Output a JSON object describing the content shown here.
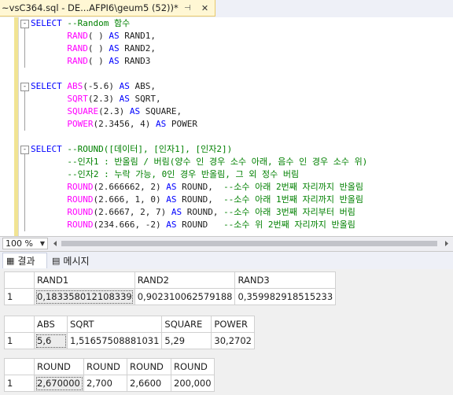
{
  "tab": {
    "title": "~vsC364.sql - DE...AFPI6\\geum5 (52))*",
    "pin_glyph": "⊣",
    "close_glyph": "✕"
  },
  "editor": {
    "lines": [
      {
        "fold": "-",
        "tokens": [
          {
            "t": "SELECT",
            "c": "kw"
          },
          {
            "t": " --Random 함수",
            "c": "cm"
          }
        ]
      },
      {
        "fold": "",
        "tokens": [
          {
            "t": "       RAND",
            "c": "fn"
          },
          {
            "t": "( ) ",
            "c": "pl"
          },
          {
            "t": "AS",
            "c": "kw"
          },
          {
            "t": " RAND1,",
            "c": "pl"
          }
        ]
      },
      {
        "fold": "",
        "tokens": [
          {
            "t": "       RAND",
            "c": "fn"
          },
          {
            "t": "( ) ",
            "c": "pl"
          },
          {
            "t": "AS",
            "c": "kw"
          },
          {
            "t": " RAND2,",
            "c": "pl"
          }
        ]
      },
      {
        "fold": "",
        "tokens": [
          {
            "t": "       RAND",
            "c": "fn"
          },
          {
            "t": "( ) ",
            "c": "pl"
          },
          {
            "t": "AS",
            "c": "kw"
          },
          {
            "t": " RAND3",
            "c": "pl"
          }
        ]
      },
      {
        "fold": "",
        "tokens": []
      },
      {
        "fold": "-",
        "tokens": [
          {
            "t": "SELECT",
            "c": "kw"
          },
          {
            "t": " ABS",
            "c": "fn"
          },
          {
            "t": "(-5.6) ",
            "c": "pl"
          },
          {
            "t": "AS",
            "c": "kw"
          },
          {
            "t": " ABS,",
            "c": "pl"
          }
        ]
      },
      {
        "fold": "",
        "tokens": [
          {
            "t": "       SQRT",
            "c": "fn"
          },
          {
            "t": "(2.3) ",
            "c": "pl"
          },
          {
            "t": "AS",
            "c": "kw"
          },
          {
            "t": " SQRT,",
            "c": "pl"
          }
        ]
      },
      {
        "fold": "",
        "tokens": [
          {
            "t": "       SQUARE",
            "c": "fn"
          },
          {
            "t": "(2.3) ",
            "c": "pl"
          },
          {
            "t": "AS",
            "c": "kw"
          },
          {
            "t": " SQUARE,",
            "c": "pl"
          }
        ]
      },
      {
        "fold": "",
        "tokens": [
          {
            "t": "       POWER",
            "c": "fn"
          },
          {
            "t": "(2.3456, 4) ",
            "c": "pl"
          },
          {
            "t": "AS",
            "c": "kw"
          },
          {
            "t": " POWER",
            "c": "pl"
          }
        ]
      },
      {
        "fold": "",
        "tokens": []
      },
      {
        "fold": "-",
        "tokens": [
          {
            "t": "SELECT",
            "c": "kw"
          },
          {
            "t": " --ROUND([데이터], [인자1], [인자2])",
            "c": "cm"
          }
        ]
      },
      {
        "fold": "",
        "tokens": [
          {
            "t": "       --인자1 : 반올림 / 버림(양수 인 경우 소수 아래, 음수 인 경우 소수 위)",
            "c": "cm"
          }
        ]
      },
      {
        "fold": "",
        "tokens": [
          {
            "t": "       --인자2 : 누락 가능, 0인 경우 반올림, 그 외 정수 버림",
            "c": "cm"
          }
        ]
      },
      {
        "fold": "",
        "tokens": [
          {
            "t": "       ROUND",
            "c": "fn"
          },
          {
            "t": "(2.666662, 2) ",
            "c": "pl"
          },
          {
            "t": "AS",
            "c": "kw"
          },
          {
            "t": " ROUND,  ",
            "c": "pl"
          },
          {
            "t": "--소수 아래 2번째 자리까지 반올림",
            "c": "cm"
          }
        ]
      },
      {
        "fold": "",
        "tokens": [
          {
            "t": "       ROUND",
            "c": "fn"
          },
          {
            "t": "(2.666, 1, 0) ",
            "c": "pl"
          },
          {
            "t": "AS",
            "c": "kw"
          },
          {
            "t": " ROUND,  ",
            "c": "pl"
          },
          {
            "t": "--소수 아래 1번째 자리까지 반올림",
            "c": "cm"
          }
        ]
      },
      {
        "fold": "",
        "tokens": [
          {
            "t": "       ROUND",
            "c": "fn"
          },
          {
            "t": "(2.6667, 2, 7) ",
            "c": "pl"
          },
          {
            "t": "AS",
            "c": "kw"
          },
          {
            "t": " ROUND, ",
            "c": "pl"
          },
          {
            "t": "--소수 아래 3번째 자리부터 버림",
            "c": "cm"
          }
        ]
      },
      {
        "fold": "",
        "tokens": [
          {
            "t": "       ROUND",
            "c": "fn"
          },
          {
            "t": "(234.666, -2) ",
            "c": "pl"
          },
          {
            "t": "AS",
            "c": "kw"
          },
          {
            "t": " ROUND   ",
            "c": "pl"
          },
          {
            "t": "--소수 위 2번째 자리까지 반올림",
            "c": "cm"
          }
        ]
      }
    ]
  },
  "zoom": {
    "value": "100 %",
    "arrow": "▼"
  },
  "result_tabs": [
    {
      "label": "결과",
      "icon": "grid-icon",
      "glyph": "▦"
    },
    {
      "label": "메시지",
      "icon": "message-icon",
      "glyph": "▤"
    }
  ],
  "grids": [
    {
      "columns": [
        "RAND1",
        "RAND2",
        "RAND3"
      ],
      "rows": [
        {
          "num": "1",
          "cells": [
            "0,183358012108339",
            "0,902310062579188",
            "0,359982918515233"
          ]
        }
      ]
    },
    {
      "columns": [
        "ABS",
        "SQRT",
        "SQUARE",
        "POWER"
      ],
      "rows": [
        {
          "num": "1",
          "cells": [
            "5,6",
            "1,51657508881031",
            "5,29",
            "30,2702"
          ]
        }
      ]
    },
    {
      "columns": [
        "ROUND",
        "ROUND",
        "ROUND",
        "ROUND"
      ],
      "rows": [
        {
          "num": "1",
          "cells": [
            "2,670000",
            "2,700",
            "2,6600",
            "200,000"
          ]
        }
      ]
    }
  ]
}
